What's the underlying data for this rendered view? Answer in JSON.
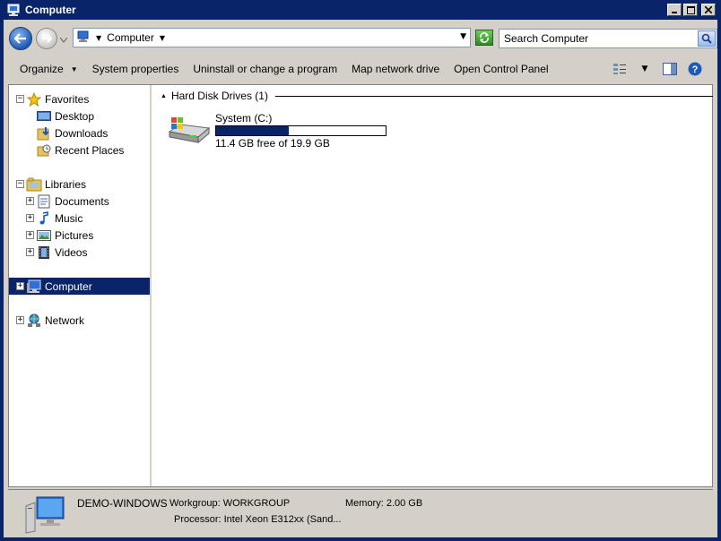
{
  "window": {
    "title": "Computer",
    "icons": {
      "app": "computer-icon",
      "minimize": "minimize-icon",
      "maximize": "maximize-icon",
      "close": "close-icon"
    }
  },
  "navigation": {
    "address": {
      "location": "Computer"
    },
    "search": {
      "placeholder": "Search Computer"
    }
  },
  "command_bar": {
    "organize": "Organize",
    "system_properties": "System properties",
    "uninstall": "Uninstall or change a program",
    "map_drive": "Map network drive",
    "control_panel": "Open Control Panel"
  },
  "tree": {
    "favorites": {
      "label": "Favorites",
      "expander": "−",
      "items": [
        {
          "label": "Desktop",
          "icon": "desktop-icon"
        },
        {
          "label": "Downloads",
          "icon": "downloads-icon"
        },
        {
          "label": "Recent Places",
          "icon": "recent-places-icon"
        }
      ]
    },
    "libraries": {
      "label": "Libraries",
      "expander": "−",
      "items": [
        {
          "label": "Documents",
          "icon": "documents-icon",
          "expander": "+"
        },
        {
          "label": "Music",
          "icon": "music-icon",
          "expander": "+"
        },
        {
          "label": "Pictures",
          "icon": "pictures-icon",
          "expander": "+"
        },
        {
          "label": "Videos",
          "icon": "videos-icon",
          "expander": "+"
        }
      ]
    },
    "computer": {
      "label": "Computer",
      "expander": "+",
      "selected": true
    },
    "network": {
      "label": "Network",
      "expander": "+"
    }
  },
  "content": {
    "group_label": "Hard Disk Drives (1)",
    "drives": [
      {
        "name": "System (C:)",
        "free_text": "11.4 GB free of 19.9 GB",
        "used_fraction": 0.43
      }
    ]
  },
  "details": {
    "computer_name": "DEMO-WINDOWS",
    "workgroup": "Workgroup: WORKGROUP",
    "memory": "Memory: 2.00 GB",
    "processor": "Processor: Intel Xeon E312xx (Sand..."
  },
  "colors": {
    "title_bar": "#0a246a",
    "selection": "#0a246a",
    "drive_bar": "#0a246a",
    "chrome": "#d4d0c8"
  }
}
